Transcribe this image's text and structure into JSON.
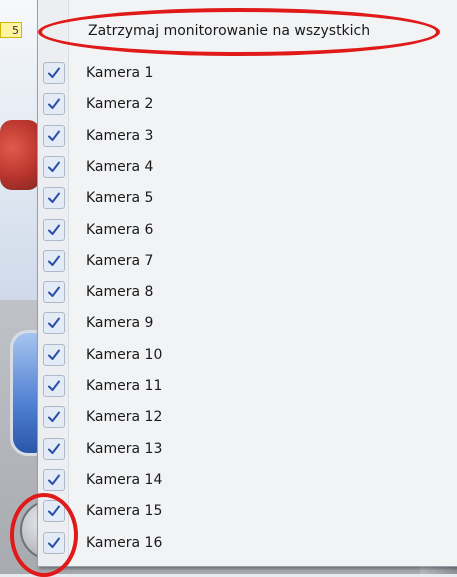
{
  "background": {
    "corner_tag": "5"
  },
  "menu": {
    "header_label": "Zatrzymaj monitorowanie na wszystkich",
    "items": [
      {
        "label": "Kamera 1",
        "checked": true
      },
      {
        "label": "Kamera 2",
        "checked": true
      },
      {
        "label": "Kamera 3",
        "checked": true
      },
      {
        "label": "Kamera 4",
        "checked": true
      },
      {
        "label": "Kamera 5",
        "checked": true
      },
      {
        "label": "Kamera 6",
        "checked": true
      },
      {
        "label": "Kamera 7",
        "checked": true
      },
      {
        "label": "Kamera 8",
        "checked": true
      },
      {
        "label": "Kamera 9",
        "checked": true
      },
      {
        "label": "Kamera 10",
        "checked": true
      },
      {
        "label": "Kamera 11",
        "checked": true
      },
      {
        "label": "Kamera 12",
        "checked": true
      },
      {
        "label": "Kamera 13",
        "checked": true
      },
      {
        "label": "Kamera 14",
        "checked": true
      },
      {
        "label": "Kamera 15",
        "checked": true
      },
      {
        "label": "Kamera 16",
        "checked": true
      }
    ]
  },
  "colors": {
    "annotation": "#e01919",
    "check": "#2b4fa8"
  },
  "icons": {
    "check": "checkmark-icon"
  }
}
